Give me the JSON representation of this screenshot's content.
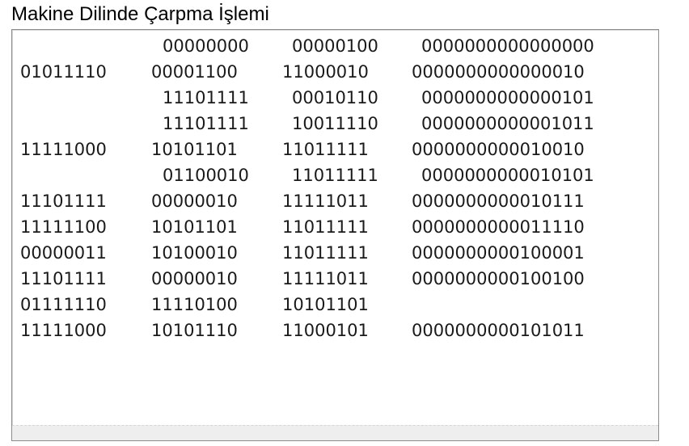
{
  "title": "Makine Dilinde Çarpma İşlemi",
  "rows": [
    [
      "",
      "00000000",
      "00000100",
      "0000000000000000"
    ],
    [
      "01011110",
      "00001100",
      "11000010",
      "0000000000000010"
    ],
    [
      "",
      "11101111",
      "00010110",
      "0000000000000101"
    ],
    [
      "",
      "11101111",
      "10011110",
      "0000000000001011"
    ],
    [
      "11111000",
      "10101101",
      "11011111",
      "0000000000010010"
    ],
    [
      "",
      "01100010",
      "11011111",
      "0000000000010101"
    ],
    [
      "11101111",
      "00000010",
      "11111011",
      "0000000000010111"
    ],
    [
      "11111100",
      "10101101",
      "11011111",
      "0000000000011110"
    ],
    [
      "00000011",
      "10100010",
      "11011111",
      "0000000000100001"
    ],
    [
      "11101111",
      "00000010",
      "11111011",
      "0000000000100100"
    ],
    [
      "01111110",
      "11110100",
      "10101101",
      ""
    ],
    [
      "11111000",
      "10101110",
      "11000101",
      "0000000000101011"
    ]
  ]
}
